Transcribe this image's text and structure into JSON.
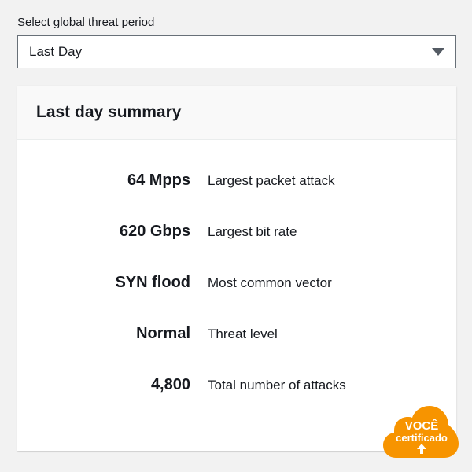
{
  "form": {
    "period_label": "Select global threat period",
    "period_value": "Last Day"
  },
  "summary": {
    "title": "Last day summary",
    "metrics": [
      {
        "value": "64 Mpps",
        "label": "Largest packet attack"
      },
      {
        "value": "620 Gbps",
        "label": "Largest bit rate"
      },
      {
        "value": "SYN flood",
        "label": "Most common vector"
      },
      {
        "value": "Normal",
        "label": "Threat level"
      },
      {
        "value": "4,800",
        "label": "Total number of attacks"
      }
    ]
  },
  "badge": {
    "line1": "VOCÊ",
    "line2": "certificado",
    "color": "#f79400"
  }
}
